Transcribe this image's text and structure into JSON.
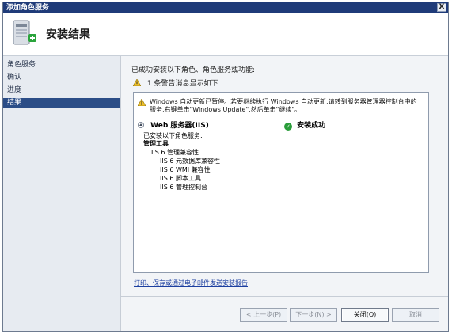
{
  "window": {
    "title": "添加角色服务",
    "close_glyph": "X"
  },
  "header": {
    "title": "安装结果"
  },
  "nav": {
    "items": [
      {
        "label": "角色服务"
      },
      {
        "label": "确认"
      },
      {
        "label": "进度"
      },
      {
        "label": "结果"
      }
    ]
  },
  "content": {
    "intro": "已成功安装以下角色、角色服务或功能:",
    "warning_summary": "1 条警告消息显示如下",
    "warning_text": "Windows 自动更新已暂停。若要继续执行 Windows 自动更新,请转到服务器管理器控制台中的服务,右键单击\"Windows Update\",然后单击\"继续\"。",
    "role_title": "Web 服务器(IIS)",
    "status": "安装成功",
    "installed_label": "已安装以下角色服务:",
    "group": "管理工具",
    "tree": [
      {
        "label": "IIS 6 管理兼容性",
        "level": 1
      },
      {
        "label": "IIS 6 元数据库兼容性",
        "level": 2
      },
      {
        "label": "IIS 6 WMI 兼容性",
        "level": 2
      },
      {
        "label": "IIS 6 脚本工具",
        "level": 2
      },
      {
        "label": "IIS 6 管理控制台",
        "level": 2
      }
    ],
    "report_link": "打印、保存或通过电子邮件发送安装报告"
  },
  "buttons": {
    "back": "< 上一步(P)",
    "next": "下一步(N) >",
    "close": "关闭(O)",
    "cancel": "取消"
  },
  "colors": {
    "titlebar": "#1f3b79",
    "selected_nav": "#2b4d87",
    "success": "#2a9d3a",
    "link": "#1c3fa0"
  },
  "icons": {
    "header": "server-add-icon",
    "warning": "warning-icon",
    "success": "success-check-icon"
  }
}
